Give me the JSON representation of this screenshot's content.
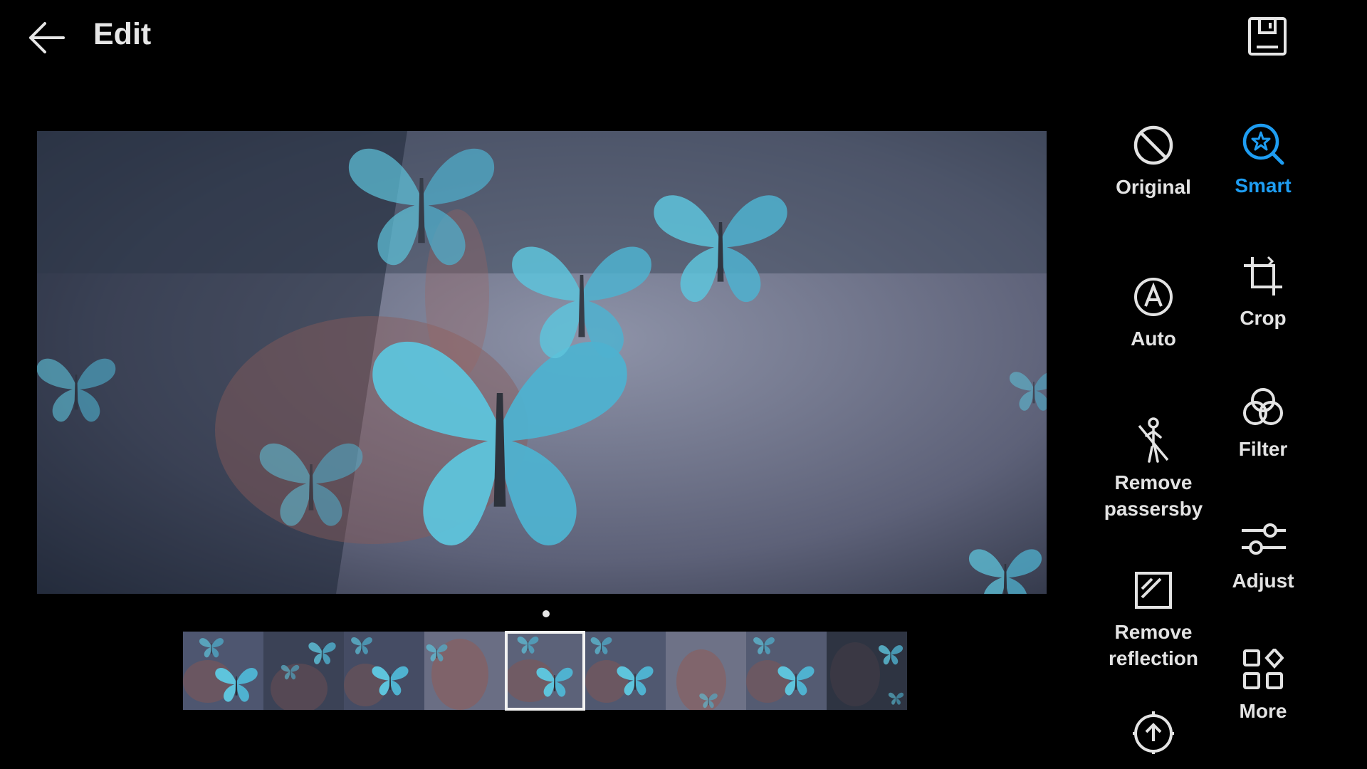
{
  "header": {
    "title": "Edit",
    "back_icon": "arrow-left-icon",
    "save_icon": "save-icon"
  },
  "colors": {
    "background": "#000000",
    "accent": "#1e9df2",
    "text": "#e3e3e3"
  },
  "filmstrip": {
    "frame_count": 9,
    "selected_index": 4
  },
  "tools": {
    "original": {
      "label": "Original",
      "icon": "no-entry-icon"
    },
    "smart": {
      "label": "Smart",
      "icon": "smart-magnifier-icon",
      "active": true
    },
    "auto": {
      "label": "Auto",
      "icon": "auto-a-icon"
    },
    "crop": {
      "label": "Crop",
      "icon": "crop-icon"
    },
    "filter": {
      "label": "Filter",
      "icon": "filter-circles-icon"
    },
    "remove_passersby": {
      "label": "Remove\npassersby",
      "icon": "remove-person-icon"
    },
    "adjust": {
      "label": "Adjust",
      "icon": "sliders-icon"
    },
    "remove_reflection": {
      "label": "Remove\nreflection",
      "icon": "reflection-icon"
    },
    "more": {
      "label": "More",
      "icon": "grid-more-icon"
    },
    "export": {
      "icon": "upload-circle-icon"
    }
  }
}
